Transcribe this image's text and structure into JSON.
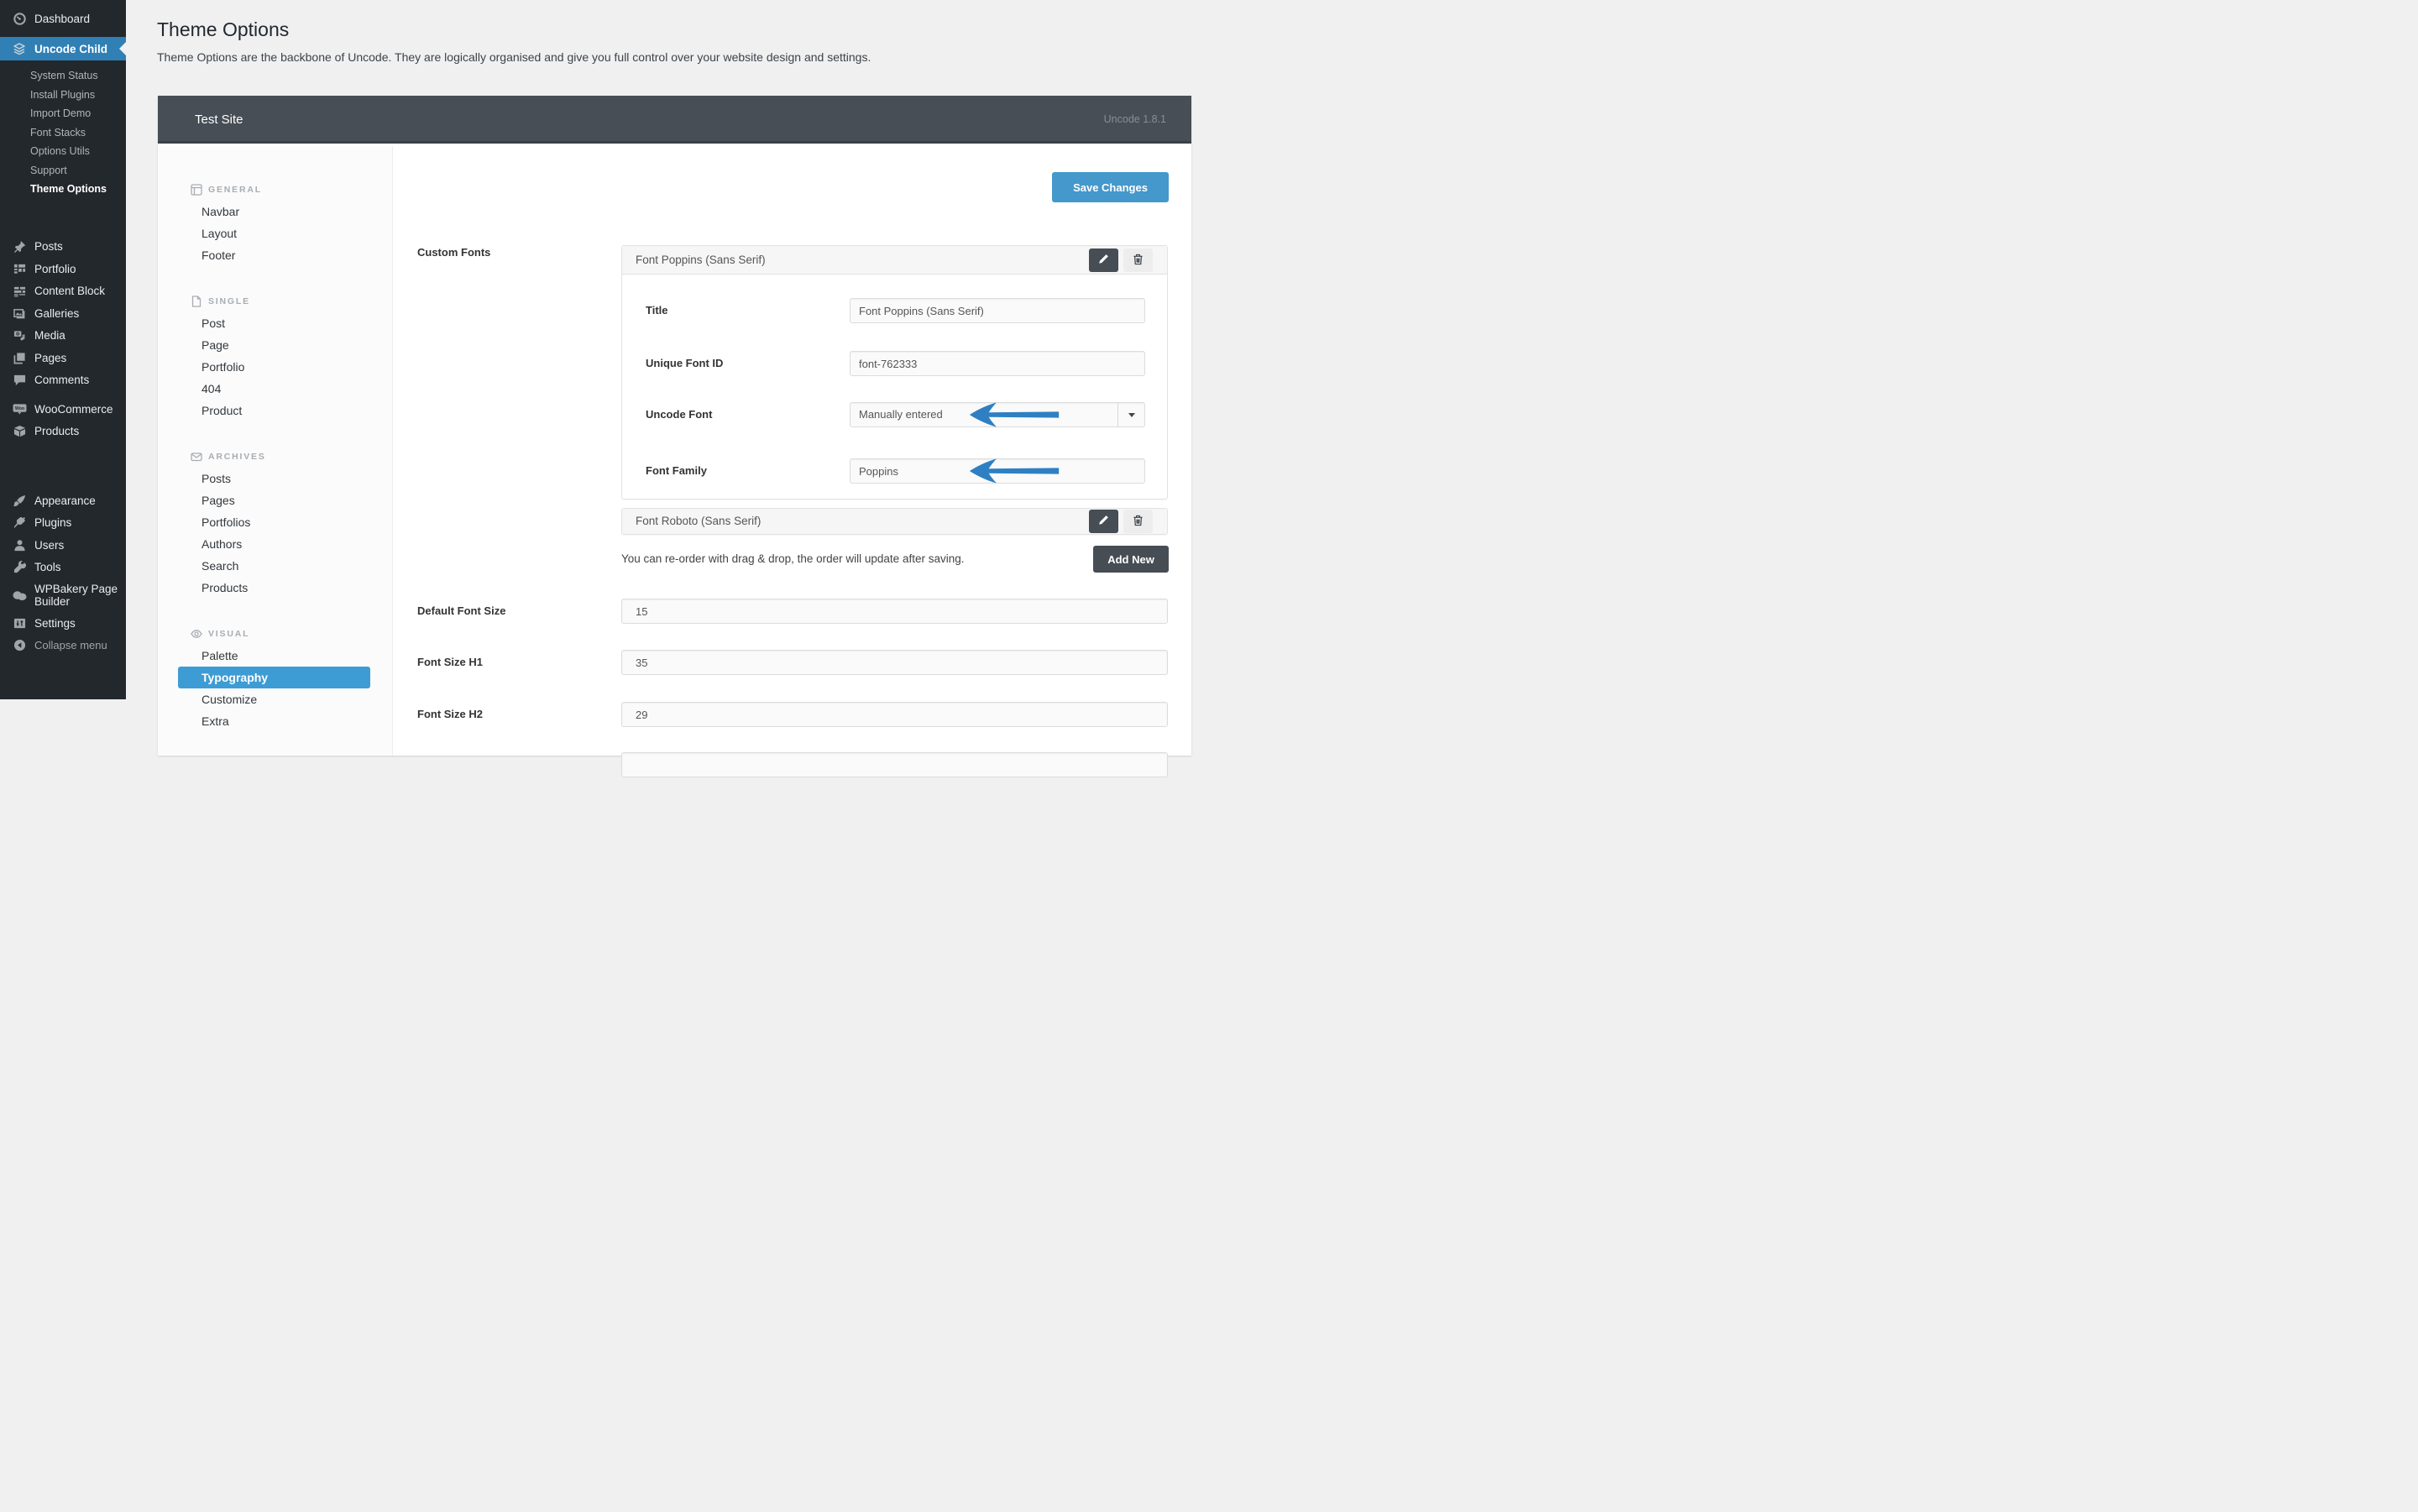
{
  "sidebar": {
    "dashboard": "Dashboard",
    "uncode": "Uncode Child",
    "sub": [
      "System Status",
      "Install Plugins",
      "Import Demo",
      "Font Stacks",
      "Options Utils",
      "Support",
      "Theme Options"
    ],
    "group1": [
      "Posts",
      "Portfolio",
      "Content Block",
      "Galleries",
      "Media",
      "Pages",
      "Comments"
    ],
    "group2": [
      "WooCommerce",
      "Products"
    ],
    "group3": [
      "Appearance",
      "Plugins",
      "Users",
      "Tools",
      "WPBakery Page Builder",
      "Settings"
    ],
    "collapse": "Collapse menu"
  },
  "page": {
    "title": "Theme Options",
    "description": "Theme Options are the backbone of Uncode. They are logically organised and give you full control over your website design and settings."
  },
  "panel": {
    "site_title": "Test Site",
    "version": "Uncode 1.8.1"
  },
  "subnav": {
    "sections": [
      {
        "title": "GENERAL",
        "icon": "layout-icon",
        "items": [
          "Navbar",
          "Layout",
          "Footer"
        ]
      },
      {
        "title": "SINGLE",
        "icon": "file-icon",
        "items": [
          "Post",
          "Page",
          "Portfolio",
          "404",
          "Product"
        ]
      },
      {
        "title": "ARCHIVES",
        "icon": "envelope-icon",
        "items": [
          "Posts",
          "Pages",
          "Portfolios",
          "Authors",
          "Search",
          "Products"
        ]
      },
      {
        "title": "VISUAL",
        "icon": "eye-icon",
        "items": [
          "Palette",
          "Typography",
          "Customize",
          "Extra"
        ]
      }
    ],
    "active_item": "Typography"
  },
  "toolbar": {
    "save_label": "Save Changes"
  },
  "form": {
    "custom_fonts_label": "Custom Fonts",
    "font_groups": [
      {
        "title": "Font Poppins (Sans Serif)",
        "expanded": true,
        "fields": [
          {
            "label": "Title",
            "value": "Font Poppins (Sans Serif)",
            "type": "text"
          },
          {
            "label": "Unique Font ID",
            "value": "font-762333",
            "type": "text"
          },
          {
            "label": "Uncode Font",
            "value": "Manually entered",
            "type": "select",
            "annotated": true
          },
          {
            "label": "Font Family",
            "value": "Poppins",
            "type": "text",
            "annotated": true
          }
        ]
      },
      {
        "title": "Font Roboto (Sans Serif)",
        "expanded": false
      }
    ],
    "reorder_note": "You can re-order with drag & drop, the order will update after saving.",
    "add_new_label": "Add New",
    "size_fields": [
      {
        "label": "Default Font Size",
        "value": "15"
      },
      {
        "label": "Font Size H1",
        "value": "35"
      },
      {
        "label": "Font Size H2",
        "value": "29"
      }
    ]
  },
  "colors": {
    "save_button": "#4498cb",
    "subnav_active": "#3e9cd4",
    "annotation_arrow": "#2e80c3",
    "sidebar_active": "#3080b5",
    "panel_header": "#474e55"
  }
}
